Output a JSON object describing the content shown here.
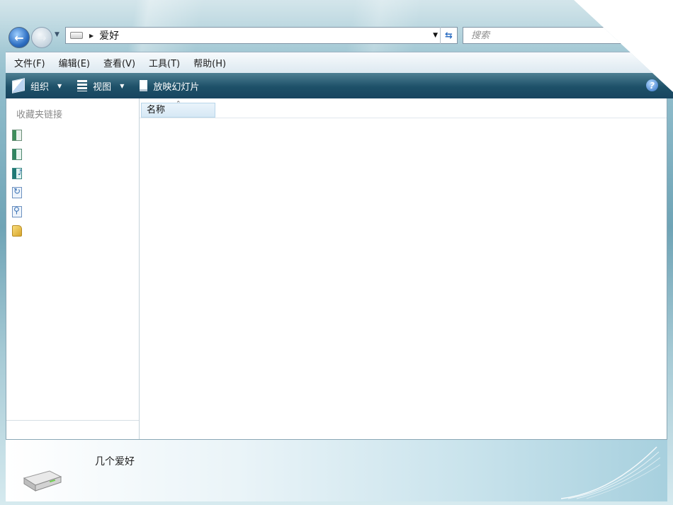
{
  "address_bar": {
    "location": "爱好"
  },
  "search": {
    "placeholder": "搜索"
  },
  "menu": [
    "文件(F)",
    "编辑(E)",
    "查看(V)",
    "工具(T)",
    "帮助(H)"
  ],
  "toolbar": {
    "organize": "组织",
    "views": "视图",
    "slideshow": "放映幻灯片"
  },
  "navigation_pane": {
    "title": "收藏夹链接",
    "favorite_icons": [
      "documents-icon",
      "pictures-icon",
      "music-icon",
      "recently-changed-icon",
      "searches-icon",
      "public-folder-icon"
    ]
  },
  "file_list": {
    "columns": [
      "名称"
    ]
  },
  "details_pane": {
    "folder_name": "几个爱好"
  }
}
